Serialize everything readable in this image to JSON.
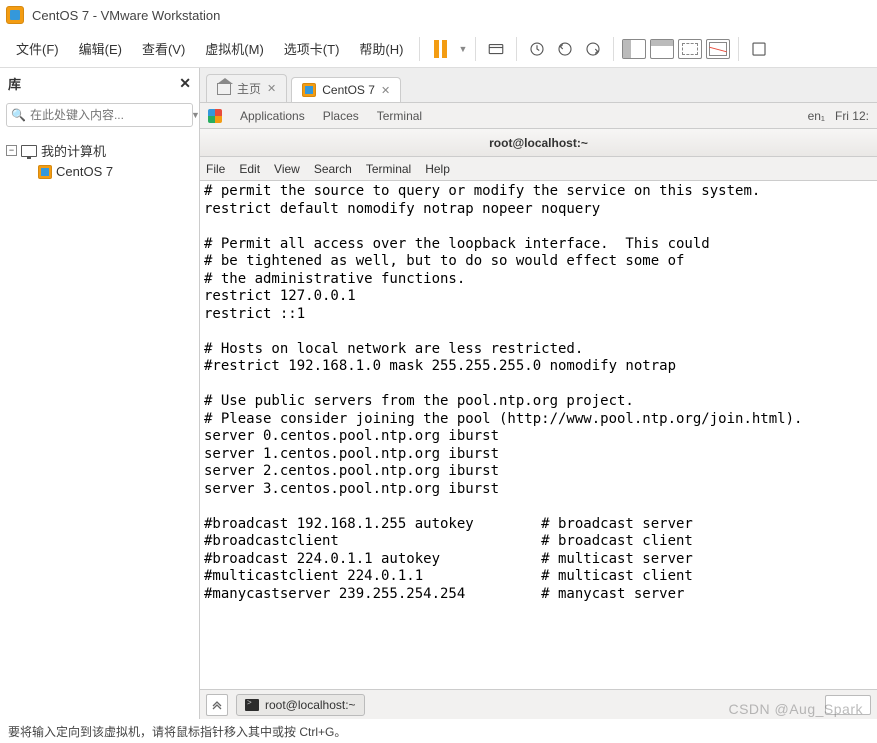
{
  "titlebar": {
    "title": "CentOS 7 - VMware Workstation"
  },
  "menubar": {
    "items": [
      "文件(F)",
      "编辑(E)",
      "查看(V)",
      "虚拟机(M)",
      "选项卡(T)",
      "帮助(H)"
    ]
  },
  "sidebar": {
    "title": "库",
    "search_placeholder": "在此处键入内容...",
    "tree": {
      "root": "我的计算机",
      "child": "CentOS 7"
    }
  },
  "vmtabs": {
    "home": "主页",
    "active_vm": "CentOS 7"
  },
  "gnome": {
    "apps": "Applications",
    "places": "Places",
    "terminal": "Terminal",
    "lang": "en₁",
    "clock": "Fri 12:"
  },
  "terminal": {
    "title": "root@localhost:~",
    "task_label": "root@localhost:~",
    "menu": [
      "File",
      "Edit",
      "View",
      "Search",
      "Terminal",
      "Help"
    ],
    "content": "# permit the source to query or modify the service on this system.\nrestrict default nomodify notrap nopeer noquery\n\n# Permit all access over the loopback interface.  This could\n# be tightened as well, but to do so would effect some of\n# the administrative functions.\nrestrict 127.0.0.1\nrestrict ::1\n\n# Hosts on local network are less restricted.\n#restrict 192.168.1.0 mask 255.255.255.0 nomodify notrap\n\n# Use public servers from the pool.ntp.org project.\n# Please consider joining the pool (http://www.pool.ntp.org/join.html).\nserver 0.centos.pool.ntp.org iburst\nserver 1.centos.pool.ntp.org iburst\nserver 2.centos.pool.ntp.org iburst\nserver 3.centos.pool.ntp.org iburst\n\n#broadcast 192.168.1.255 autokey        # broadcast server\n#broadcastclient                        # broadcast client\n#broadcast 224.0.1.1 autokey            # multicast server\n#multicastclient 224.0.1.1              # multicast client\n#manycastserver 239.255.254.254         # manycast server"
  },
  "statusbar": {
    "text": "要将输入定向到该虚拟机，请将鼠标指针移入其中或按 Ctrl+G。"
  },
  "watermark": "CSDN @Aug_Spark"
}
